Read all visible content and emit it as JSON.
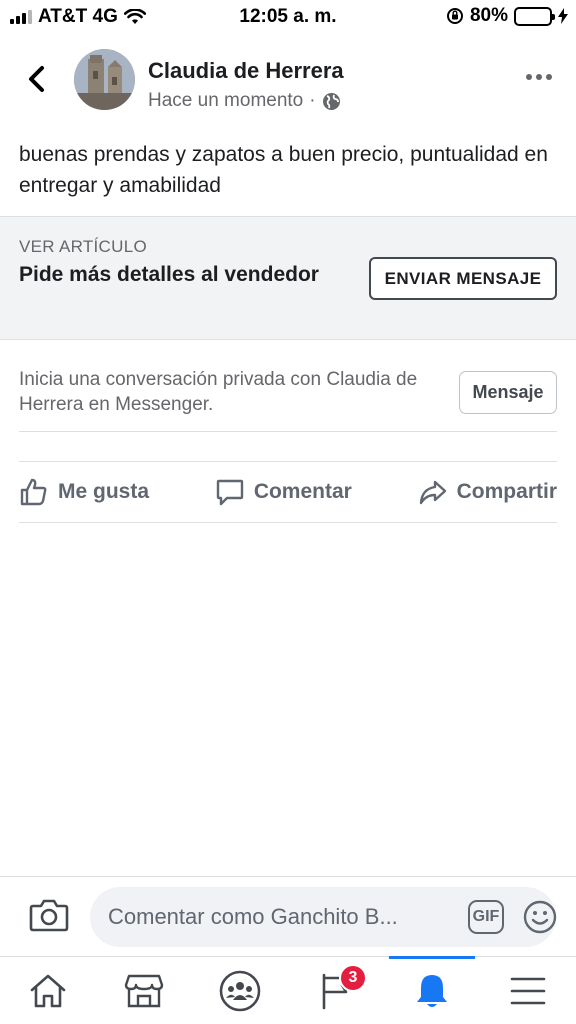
{
  "status_bar": {
    "carrier": "AT&T 4G",
    "time": "12:05 a. m.",
    "battery_percent": "80%",
    "battery_level": 0.8,
    "battery_color": "#4cd964"
  },
  "post": {
    "author": "Claudia de Herrera",
    "timestamp": "Hace un momento",
    "separator": "·",
    "audience_icon": "globe-icon",
    "text": "buenas prendas y zapatos a buen precio, puntualidad en entregar y amabilidad"
  },
  "marketplace": {
    "label": "VER ARTÍCULO",
    "title": "Pide más detalles al vendedor",
    "button": "ENVIAR MENSAJE"
  },
  "messenger": {
    "prompt": "Inicia una conversación privada con Claudia de Herrera en Messenger.",
    "button": "Mensaje"
  },
  "actions": {
    "like": "Me gusta",
    "comment": "Comentar",
    "share": "Compartir"
  },
  "comment_bar": {
    "placeholder": "Comentar como Ganchito B...",
    "gif_label": "GIF"
  },
  "bottom_nav": {
    "items": [
      "home-icon",
      "marketplace-icon",
      "groups-icon",
      "pages-icon",
      "notifications-icon",
      "menu-icon"
    ],
    "active": "notifications-icon",
    "pages_badge": "3",
    "accent_color": "#1877f2",
    "badge_color": "#e41e3f"
  }
}
